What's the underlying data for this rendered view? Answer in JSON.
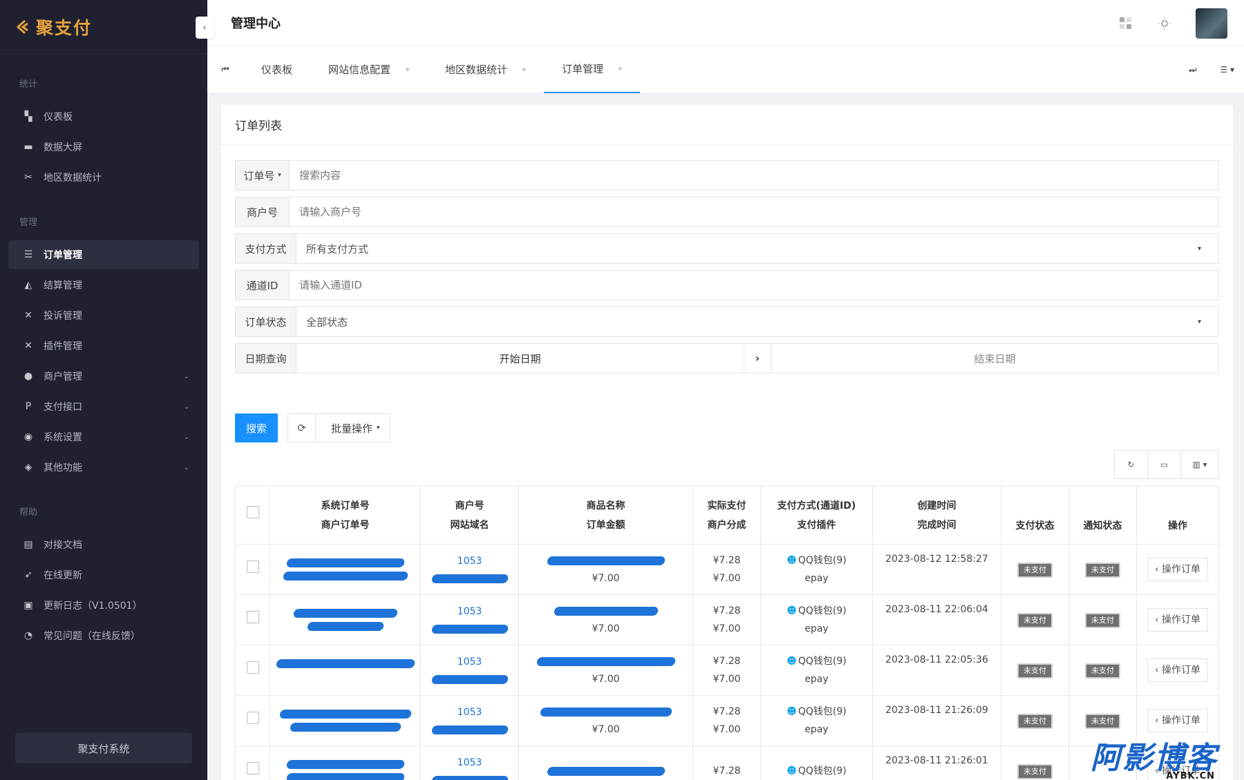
{
  "brand": {
    "name": "聚支付"
  },
  "sidebar": {
    "groups": [
      {
        "title": "统计",
        "items": [
          {
            "label": "仪表板",
            "icon": "dashboard-icon"
          },
          {
            "label": "数据大屏",
            "icon": "screen-icon"
          },
          {
            "label": "地区数据统计",
            "icon": "map-stats-icon"
          }
        ]
      },
      {
        "title": "管理",
        "items": [
          {
            "label": "订单管理",
            "icon": "list-icon",
            "active": true
          },
          {
            "label": "结算管理",
            "icon": "settlement-icon"
          },
          {
            "label": "投诉管理",
            "icon": "complaint-icon"
          },
          {
            "label": "插件管理",
            "icon": "plugin-icon"
          },
          {
            "label": "商户管理",
            "icon": "user-icon",
            "expandable": true
          },
          {
            "label": "支付接口",
            "icon": "paypal-icon",
            "expandable": true
          },
          {
            "label": "系统设置",
            "icon": "settings-icon",
            "expandable": true
          },
          {
            "label": "其他功能",
            "icon": "layers-icon",
            "expandable": true
          }
        ]
      },
      {
        "title": "帮助",
        "items": [
          {
            "label": "对接文档",
            "icon": "doc-icon"
          },
          {
            "label": "在线更新",
            "icon": "rocket-icon"
          },
          {
            "label": "更新日志（V1.0501）",
            "icon": "log-icon"
          },
          {
            "label": "常见问题（在线反馈）",
            "icon": "pie-icon"
          }
        ]
      }
    ],
    "footer": "聚支付系统"
  },
  "header": {
    "title": "管理中心"
  },
  "tabs": [
    {
      "label": "仪表板",
      "dot": false
    },
    {
      "label": "网站信息配置",
      "dot": true
    },
    {
      "label": "地区数据统计",
      "dot": true
    },
    {
      "label": "订单管理",
      "dot": true,
      "active": true
    }
  ],
  "card": {
    "title": "订单列表"
  },
  "filters": {
    "order_no": {
      "label": "订单号",
      "placeholder": "搜索内容"
    },
    "merchant": {
      "label": "商户号",
      "placeholder": "请输入商户号"
    },
    "pay_method": {
      "label": "支付方式",
      "value": "所有支付方式"
    },
    "channel": {
      "label": "通道ID",
      "placeholder": "请输入通道ID"
    },
    "status": {
      "label": "订单状态",
      "value": "全部状态"
    },
    "date": {
      "label": "日期查询",
      "start": "开始日期",
      "end": "结束日期"
    }
  },
  "actions": {
    "search": "搜索",
    "batch": "批量操作"
  },
  "table": {
    "headers": {
      "order": [
        "系统订单号",
        "商户订单号"
      ],
      "merchant": [
        "商户号",
        "网站域名"
      ],
      "product": [
        "商品名称",
        "订单金额"
      ],
      "actual": [
        "实际支付",
        "商户分成"
      ],
      "method": [
        "支付方式(通道ID)",
        "支付插件"
      ],
      "time": [
        "创建时间",
        "完成时间"
      ],
      "pay_status": "支付状态",
      "notify_status": "通知状态",
      "op": "操作"
    },
    "rows": [
      {
        "merchant": "1053",
        "amount": "¥7.00",
        "actual": "¥7.28",
        "share": "¥7.00",
        "method": "QQ钱包(9)",
        "plugin": "epay",
        "created": "2023-08-12 12:58:27",
        "pay_status": "未支付",
        "notify_status": "未支付",
        "op": "操作订单"
      },
      {
        "merchant": "1053",
        "amount": "¥7.00",
        "actual": "¥7.28",
        "share": "¥7.00",
        "method": "QQ钱包(9)",
        "plugin": "epay",
        "created": "2023-08-11 22:06:04",
        "pay_status": "未支付",
        "notify_status": "未支付",
        "op": "操作订单"
      },
      {
        "merchant": "1053",
        "amount": "¥7.00",
        "actual": "¥7.28",
        "share": "¥7.00",
        "method": "QQ钱包(9)",
        "plugin": "epay",
        "created": "2023-08-11 22:05:36",
        "pay_status": "未支付",
        "notify_status": "未支付",
        "op": "操作订单"
      },
      {
        "merchant": "1053",
        "amount": "¥7.00",
        "actual": "¥7.28",
        "share": "¥7.00",
        "method": "QQ钱包(9)",
        "plugin": "epay",
        "created": "2023-08-11 21:26:09",
        "pay_status": "未支付",
        "notify_status": "未支付",
        "op": "操作订单"
      },
      {
        "merchant": "1053",
        "amount": "",
        "actual": "¥7.28",
        "share": "",
        "method": "QQ钱包(9)",
        "plugin": "",
        "created": "2023-08-11 21:26:01",
        "pay_status": "未支付",
        "notify_status": "",
        "op": "操作订单"
      }
    ]
  },
  "watermark": {
    "main": "阿影博客",
    "sub": "AYBK.CN"
  },
  "colors": {
    "primary": "#1890ff",
    "sidebar_bg": "#1f2130",
    "brand": "#e6a23c"
  }
}
